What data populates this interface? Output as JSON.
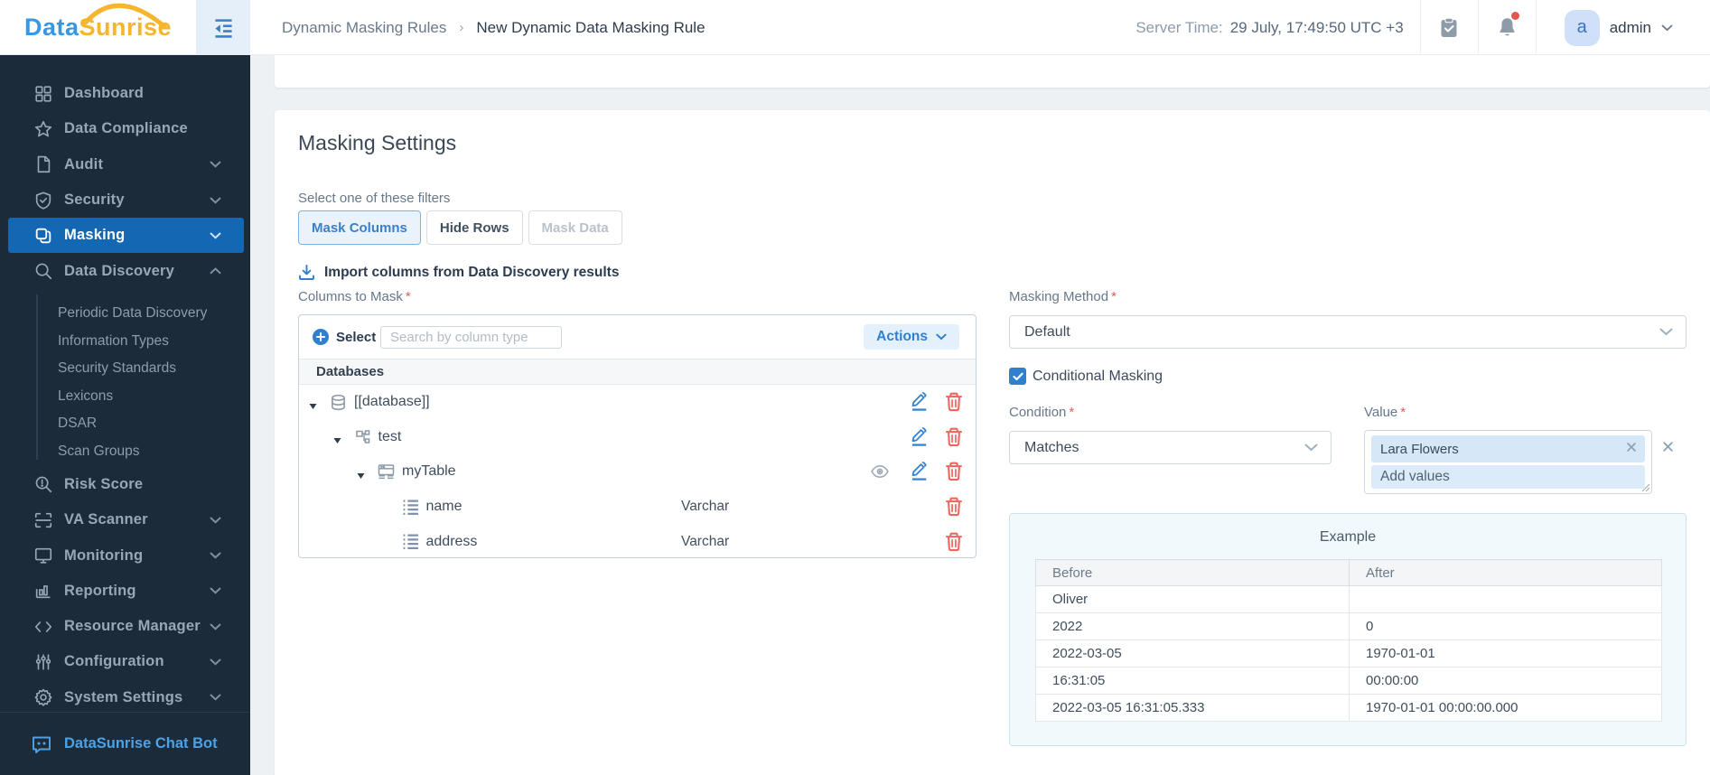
{
  "header": {
    "logo": {
      "part1": "Data",
      "part2": "Sunrise"
    },
    "breadcrumb": {
      "parent": "Dynamic Masking Rules",
      "separator": "›",
      "current": "New Dynamic Data Masking Rule"
    },
    "server_time": {
      "label": "Server Time:",
      "value": "29 July, 17:49:50 UTC +3"
    },
    "user": {
      "avatar_letter": "a",
      "name": "admin"
    }
  },
  "sidebar": {
    "items": [
      {
        "id": "dashboard",
        "label": "Dashboard",
        "icon": "dashboard-icon",
        "chevron": "",
        "active": false
      },
      {
        "id": "data-compliance",
        "label": "Data Compliance",
        "icon": "star-icon",
        "chevron": "",
        "active": false
      },
      {
        "id": "audit",
        "label": "Audit",
        "icon": "document-icon",
        "chevron": "down",
        "active": false
      },
      {
        "id": "security",
        "label": "Security",
        "icon": "shield-icon",
        "chevron": "down",
        "active": false
      },
      {
        "id": "masking",
        "label": "Masking",
        "icon": "mask-icon",
        "chevron": "down",
        "active": true
      },
      {
        "id": "data-discovery",
        "label": "Data Discovery",
        "icon": "search-icon",
        "chevron": "up",
        "active": false
      }
    ],
    "data_discovery_subitems": [
      "Periodic Data Discovery",
      "Information Types",
      "Security Standards",
      "Lexicons",
      "DSAR",
      "Scan Groups"
    ],
    "items_after": [
      {
        "id": "risk-score",
        "label": "Risk Score",
        "icon": "risk-score-icon",
        "chevron": "",
        "active": false
      },
      {
        "id": "va-scanner",
        "label": "VA Scanner",
        "icon": "scanner-icon",
        "chevron": "down",
        "active": false
      },
      {
        "id": "monitoring",
        "label": "Monitoring",
        "icon": "monitor-icon",
        "chevron": "down",
        "active": false
      },
      {
        "id": "reporting",
        "label": "Reporting",
        "icon": "chart-icon",
        "chevron": "down",
        "active": false
      },
      {
        "id": "resource-manager",
        "label": "Resource Manager",
        "icon": "code-icon",
        "chevron": "down",
        "active": false
      },
      {
        "id": "configuration",
        "label": "Configuration",
        "icon": "sliders-icon",
        "chevron": "down",
        "active": false
      },
      {
        "id": "system-settings",
        "label": "System Settings",
        "icon": "gear-icon",
        "chevron": "down",
        "active": false
      }
    ],
    "chatbot_label": "DataSunrise Chat Bot"
  },
  "main": {
    "section_title": "Masking Settings",
    "filter": {
      "label": "Select one of these filters",
      "options": [
        {
          "label": "Mask Columns",
          "state": "active"
        },
        {
          "label": "Hide Rows",
          "state": "default"
        },
        {
          "label": "Mask Data",
          "state": "disabled"
        }
      ]
    },
    "import_link": "Import columns from Data Discovery results",
    "columns_to_mask": {
      "label": "Columns to Mask",
      "required_mark": "*",
      "select_button": "Select",
      "search_placeholder": "Search by column type",
      "actions_button": "Actions",
      "group_header": "Databases",
      "tree": [
        {
          "level": 0,
          "name": "[[database]]",
          "icon": "database-icon",
          "expander": true,
          "type_label": "",
          "actions": [
            "edit",
            "delete"
          ]
        },
        {
          "level": 1,
          "name": "test",
          "icon": "schema-icon",
          "expander": true,
          "type_label": "",
          "actions": [
            "edit",
            "delete"
          ]
        },
        {
          "level": 2,
          "name": "myTable",
          "icon": "table-icon",
          "expander": true,
          "type_label": "",
          "actions": [
            "eye",
            "edit",
            "delete"
          ]
        },
        {
          "level": 3,
          "name": "name",
          "icon": "column-icon",
          "expander": false,
          "type_label": "Varchar",
          "actions": [
            "delete"
          ]
        },
        {
          "level": 3,
          "name": "address",
          "icon": "column-icon",
          "expander": false,
          "type_label": "Varchar",
          "actions": [
            "delete"
          ]
        }
      ]
    },
    "masking_method": {
      "label": "Masking Method",
      "required_mark": "*",
      "value": "Default"
    },
    "conditional_masking": {
      "label": "Conditional Masking",
      "checked": true
    },
    "condition": {
      "label": "Condition",
      "required_mark": "*",
      "value": "Matches"
    },
    "value_field": {
      "label": "Value",
      "required_mark": "*",
      "tag": "Lara Flowers",
      "placeholder": "Add values"
    },
    "example": {
      "title": "Example",
      "columns": [
        "Before",
        "After"
      ],
      "rows": [
        [
          "Oliver",
          ""
        ],
        [
          "2022",
          "0"
        ],
        [
          "2022-03-05",
          "1970-01-01"
        ],
        [
          "16:31:05",
          "00:00:00"
        ],
        [
          "2022-03-05 16:31:05.333",
          "1970-01-01 00:00:00.000"
        ]
      ]
    }
  },
  "colors": {
    "sidebar_bg": "#1c2b3a",
    "active_item": "#1467b3",
    "primary_blue": "#2f80cf",
    "danger_red": "#ee665f",
    "accent_yellow": "#f6b52e"
  }
}
